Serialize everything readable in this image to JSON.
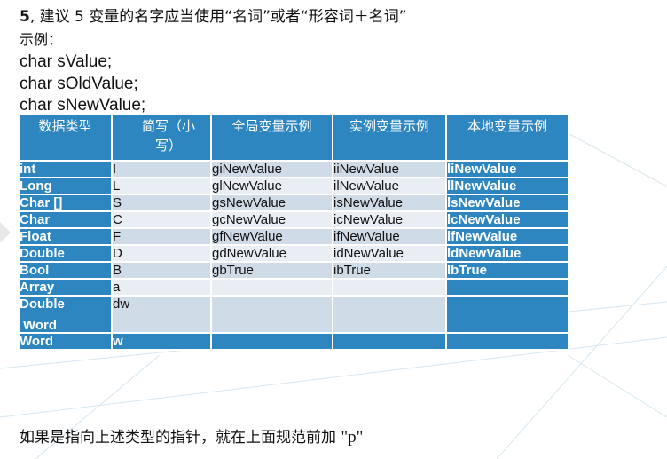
{
  "heading": {
    "number": "5",
    "text": ", 建议 5 变量的名字应当使用“名词”或者“形容词＋名词”"
  },
  "subheading": "示例：",
  "code_lines": [
    "char  sValue;",
    "char  sOldValue;",
    "char  sNewValue;"
  ],
  "table": {
    "headers": [
      "数据类型",
      "简写（小写）",
      "全局变量示例",
      "实例变量示例",
      "本地变量示例"
    ],
    "rows": [
      [
        "int",
        "I",
        "giNewValue",
        "iiNewValue",
        "liNewValue"
      ],
      [
        "Long",
        "L",
        "glNewValue",
        "ilNewValue",
        "llNewValue"
      ],
      [
        "Char []",
        "S",
        "gsNewValue",
        "isNewValue",
        "lsNewValue"
      ],
      [
        "Char",
        "C",
        "gcNewValue",
        "icNewValue",
        "lcNewValue"
      ],
      [
        "Float",
        "F",
        "gfNewValue",
        "ifNewValue",
        "lfNewValue"
      ],
      [
        "Double",
        "D",
        "gdNewValue",
        "idNewValue",
        "ldNewValue"
      ],
      [
        "Bool",
        "B",
        "gbTrue",
        "ibTrue",
        "lbTrue"
      ],
      [
        "Array",
        "a",
        "",
        "",
        ""
      ]
    ],
    "double_word_line1": "Double",
    "double_word_line2": "Word",
    "double_word_abbr": "dw",
    "word_row": [
      "Word",
      "w"
    ]
  },
  "footer": {
    "text": "如果是指向上述类型的指针，就在上面规范前加  ",
    "prefix": "\"p\""
  },
  "colors": {
    "accent_blue": "#2e86c1",
    "row_odd": "#d0dbe8",
    "row_even": "#e9eef5"
  }
}
